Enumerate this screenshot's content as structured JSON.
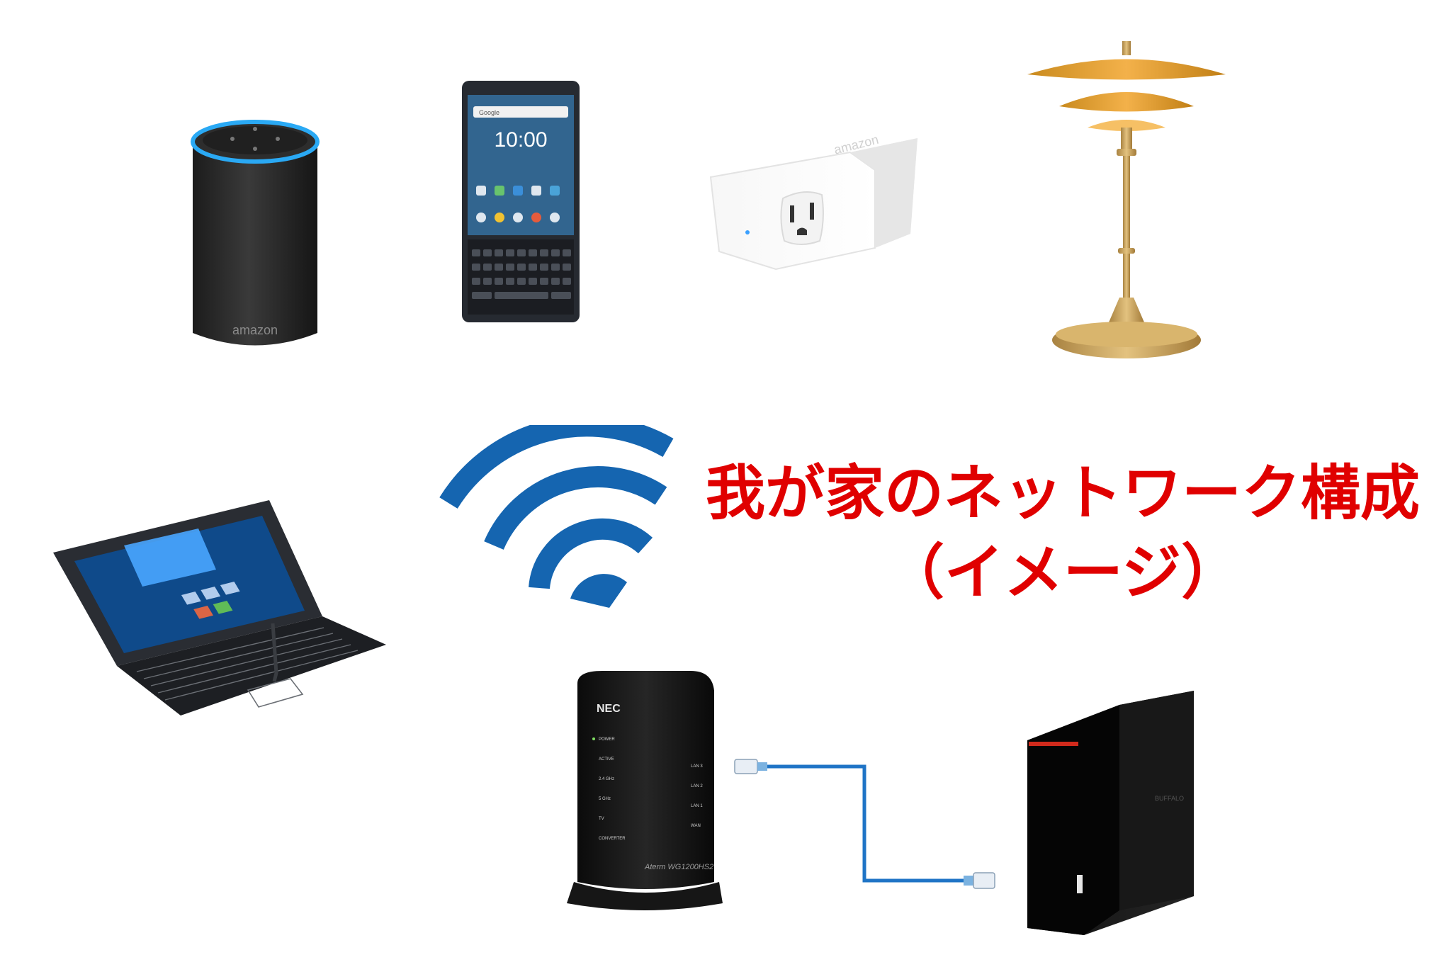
{
  "title": {
    "line1": "我が家のネットワーク構成",
    "line2": "（イメージ）"
  },
  "labels": {
    "speaker_brand": "amazon",
    "plug_brand": "amazon",
    "phone_time": "10:00",
    "phone_search": "Google",
    "router_brand": "NEC",
    "router_model": "Aterm WG1200HS2",
    "router_leds": [
      "POWER",
      "ACTIVE",
      "2.4 GHz",
      "5 GHz",
      "TV",
      "CONVERTER"
    ],
    "router_ports": [
      "LAN 3",
      "LAN 2",
      "LAN 1",
      "WAN"
    ],
    "nas_brand": "BUFFALO"
  },
  "colors": {
    "title": "#e00000",
    "wifi": "#1565b0",
    "cable": "#1f74c6",
    "echo_ring": "#2aa9f4",
    "lamp_shade": "#e09a2c",
    "lamp_brass": "#c9a35a",
    "nas_stripe": "#d12a1c"
  }
}
